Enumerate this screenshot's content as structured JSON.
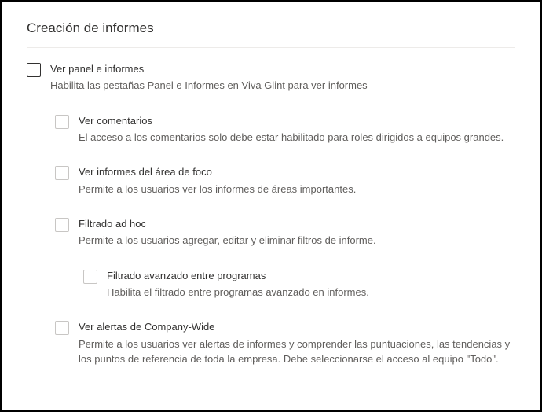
{
  "section": {
    "title": "Creación de informes"
  },
  "options": {
    "main": {
      "label": "Ver panel e informes",
      "desc": "Habilita las pestañas Panel e Informes en Viva Glint para ver informes"
    },
    "comments": {
      "label": "Ver comentarios",
      "desc": "El acceso a los comentarios solo debe estar habilitado para roles dirigidos a equipos grandes."
    },
    "focus": {
      "label": "Ver informes del área de foco",
      "desc": "Permite a los usuarios ver los informes de áreas importantes."
    },
    "adhoc": {
      "label": "Filtrado ad hoc",
      "desc": "Permite a los usuarios agregar, editar y eliminar filtros de informe."
    },
    "advanced": {
      "label": "Filtrado avanzado entre programas",
      "desc": "Habilita el filtrado entre programas avanzado en informes."
    },
    "alerts": {
      "label": "Ver alertas de Company-Wide",
      "desc": "Permite a los usuarios ver alertas de informes y comprender las puntuaciones, las tendencias y los puntos de referencia de toda la empresa. Debe seleccionarse el acceso al equipo \"Todo\"."
    }
  }
}
